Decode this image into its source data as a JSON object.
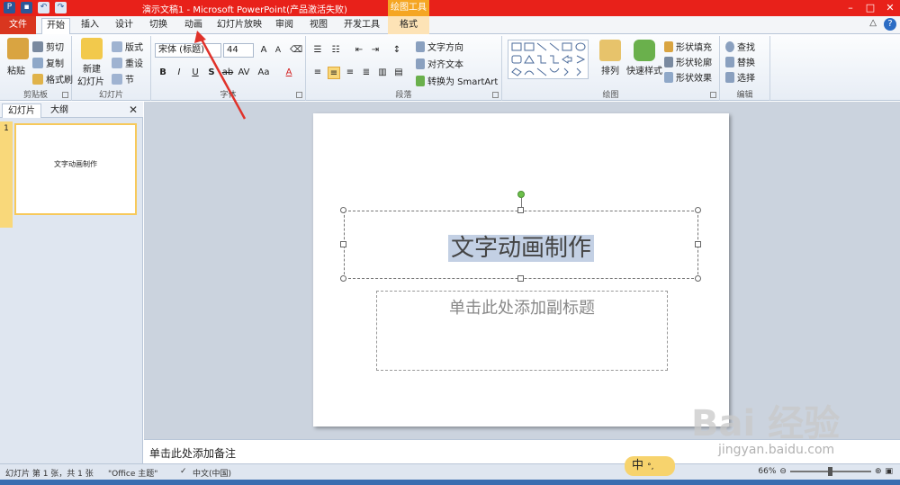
{
  "window": {
    "title": "演示文稿1  -  Microsoft PowerPoint(产品激活失败)",
    "context_tab_group": "绘图工具"
  },
  "tabs": [
    {
      "label": "文件"
    },
    {
      "label": "开始"
    },
    {
      "label": "插入"
    },
    {
      "label": "设计"
    },
    {
      "label": "切换"
    },
    {
      "label": "动画"
    },
    {
      "label": "幻灯片放映"
    },
    {
      "label": "审阅"
    },
    {
      "label": "视图"
    },
    {
      "label": "开发工具"
    },
    {
      "label": "格式"
    }
  ],
  "ribbon": {
    "clipboard": {
      "paste": "粘贴",
      "cut": "剪切",
      "copy": "复制",
      "format_painter": "格式刷",
      "label": "剪贴板"
    },
    "slides": {
      "new_slide_1": "新建",
      "new_slide_2": "幻灯片",
      "layout": "版式",
      "reset": "重设",
      "section": "节",
      "label": "幻灯片"
    },
    "font": {
      "name": "宋体 (标题)",
      "size": "44",
      "label": "字体"
    },
    "paragraph": {
      "text_direction": "文字方向",
      "align_text": "对齐文本",
      "smartart": "转换为 SmartArt",
      "label": "段落"
    },
    "drawing": {
      "arrange": "排列",
      "quick_styles": "快速样式",
      "shape_fill": "形状填充",
      "shape_outline": "形状轮廓",
      "shape_effects": "形状效果",
      "label": "绘图"
    },
    "editing": {
      "find": "查找",
      "replace": "替换",
      "select": "选择",
      "label": "编辑"
    }
  },
  "left_pane": {
    "tab_slides": "幻灯片",
    "tab_outline": "大纲",
    "slide_number": "1",
    "thumb_title": "文字动画制作"
  },
  "slide": {
    "title": "文字动画制作",
    "subtitle_placeholder": "单击此处添加副标题"
  },
  "notes": {
    "placeholder": "单击此处添加备注"
  },
  "status": {
    "slide_info": "幻灯片 第 1 张，共 1 张",
    "theme": "\"Office 主题\"",
    "language": "中文(中国)",
    "zoom": "66%"
  },
  "ime": {
    "label": "中"
  },
  "watermark": {
    "text": "Bai 经验",
    "url": "jingyan.baidu.com"
  },
  "colors": {
    "title_bar": "#e8211a",
    "file_tab": "#d9361f",
    "selection": "#c3d0e4",
    "annotation_arrow": "#e0322a"
  }
}
